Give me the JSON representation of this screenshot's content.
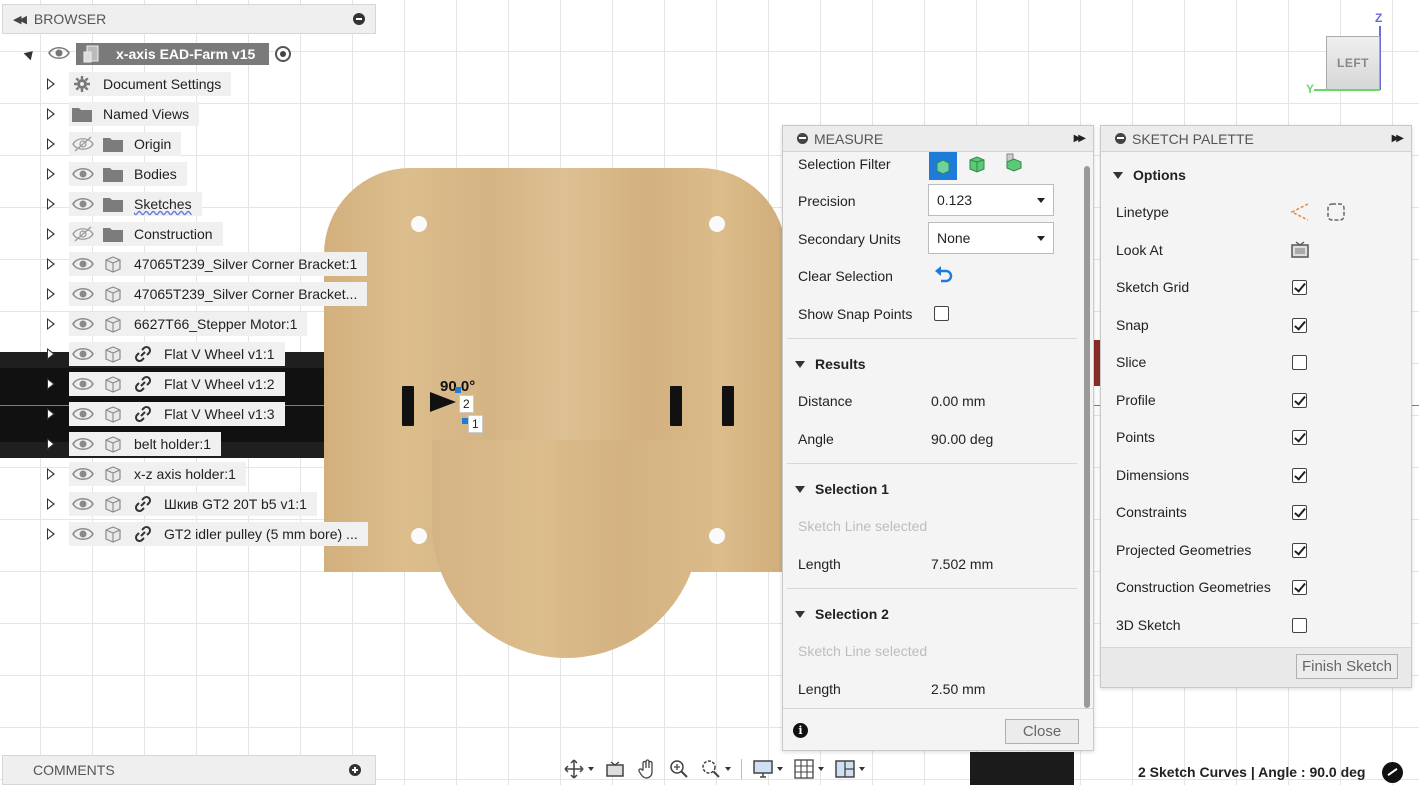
{
  "browser": {
    "title": "BROWSER",
    "root": {
      "label": "x-axis EAD-Farm v15"
    },
    "items": [
      {
        "label": "Document Settings",
        "icon": "gear-icon",
        "eye": "none",
        "link": false
      },
      {
        "label": "Named Views",
        "icon": "folder-icon",
        "eye": "none",
        "link": false
      },
      {
        "label": "Origin",
        "icon": "folder-icon",
        "eye": "hidden",
        "link": false
      },
      {
        "label": "Bodies",
        "icon": "folder-icon",
        "eye": "visible",
        "link": false
      },
      {
        "label": "Sketches",
        "icon": "folder-icon",
        "eye": "visible",
        "link": false
      },
      {
        "label": "Construction",
        "icon": "folder-icon",
        "eye": "hidden",
        "link": false
      },
      {
        "label": "47065T239_Silver Corner Bracket:1",
        "icon": "component-icon",
        "eye": "visible",
        "link": false
      },
      {
        "label": "47065T239_Silver Corner Bracket...",
        "icon": "component-icon",
        "eye": "visible",
        "link": false
      },
      {
        "label": "6627T66_Stepper Motor:1",
        "icon": "component-icon",
        "eye": "visible",
        "link": false
      },
      {
        "label": "Flat V Wheel v1:1",
        "icon": "component-icon",
        "eye": "visible",
        "link": true
      },
      {
        "label": "Flat V Wheel v1:2",
        "icon": "component-icon",
        "eye": "visible",
        "link": true
      },
      {
        "label": "Flat V Wheel v1:3",
        "icon": "component-icon",
        "eye": "visible",
        "link": true
      },
      {
        "label": "belt holder:1",
        "icon": "component-icon",
        "eye": "visible",
        "link": false
      },
      {
        "label": "x-z axis holder:1",
        "icon": "component-icon",
        "eye": "visible",
        "link": false
      },
      {
        "label": "Шкив GT2 20T b5 v1:1",
        "icon": "component-icon",
        "eye": "visible",
        "link": true
      },
      {
        "label": "GT2 idler pulley (5 mm bore) ...",
        "icon": "component-icon",
        "eye": "visible",
        "link": true
      }
    ]
  },
  "comments": {
    "title": "COMMENTS"
  },
  "canvas": {
    "angle_label": "90.0°",
    "sel_tag_1": "1",
    "sel_tag_2": "2"
  },
  "viewcube": {
    "face": "LEFT",
    "z": "Z",
    "y": "Y"
  },
  "measure": {
    "title": "MEASURE",
    "selection_filter": "Selection Filter",
    "precision_label": "Precision",
    "precision_value": "0.123",
    "secondary_units_label": "Secondary Units",
    "secondary_units_value": "None",
    "clear_selection": "Clear Selection",
    "show_snap_points": "Show Snap Points",
    "results": {
      "title": "Results",
      "distance_label": "Distance",
      "distance_value": "0.00 mm",
      "angle_label": "Angle",
      "angle_value": "90.00 deg"
    },
    "selection1": {
      "title": "Selection 1",
      "desc": "Sketch Line selected",
      "length_label": "Length",
      "length_value": "7.502 mm"
    },
    "selection2": {
      "title": "Selection 2",
      "desc": "Sketch Line selected",
      "length_label": "Length",
      "length_value": "2.50 mm"
    },
    "close": "Close"
  },
  "palette": {
    "title": "SKETCH PALETTE",
    "options_title": "Options",
    "linetype": "Linetype",
    "look_at": "Look At",
    "checks": [
      {
        "label": "Sketch Grid",
        "checked": true
      },
      {
        "label": "Snap",
        "checked": true
      },
      {
        "label": "Slice",
        "checked": false
      },
      {
        "label": "Profile",
        "checked": true
      },
      {
        "label": "Points",
        "checked": true
      },
      {
        "label": "Dimensions",
        "checked": true
      },
      {
        "label": "Constraints",
        "checked": true
      },
      {
        "label": "Projected Geometries",
        "checked": true
      },
      {
        "label": "Construction Geometries",
        "checked": true
      },
      {
        "label": "3D Sketch",
        "checked": false
      }
    ],
    "finish": "Finish Sketch"
  },
  "status": {
    "text": "2 Sketch Curves | Angle : 90.0 deg"
  },
  "colors": {
    "accent": "#1e7bd8",
    "panel": "#f4f4f4",
    "axis": "#d35b5b",
    "wood": "#d8b886"
  }
}
